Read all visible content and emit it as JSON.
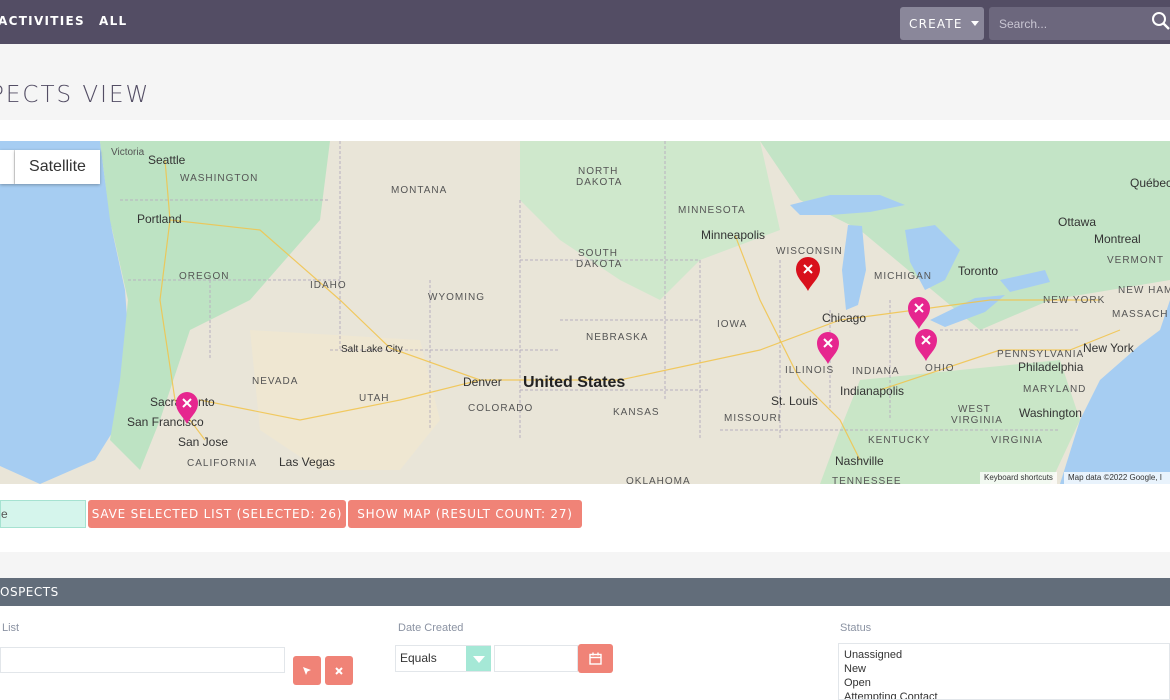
{
  "nav": {
    "items": [
      "ACTIVITIES",
      "ALL"
    ],
    "create_label": "CREATE",
    "search_placeholder": "Search..."
  },
  "page": {
    "title": "PECTS VIEW"
  },
  "map": {
    "type_satellite": "Satellite",
    "attribution_shortcuts": "Keyboard shortcuts",
    "attribution_data": "Map data ©2022 Google, I",
    "labels": {
      "victoria": "Victoria",
      "seattle": "Seattle",
      "washington": "WASHINGTON",
      "portland": "Portland",
      "oregon": "OREGON",
      "idaho": "IDAHO",
      "montana": "MONTANA",
      "wyoming": "WYOMING",
      "nevada": "NEVADA",
      "utah": "UTAH",
      "colorado": "COLORADO",
      "california": "CALIFORNIA",
      "sacramento": "Sacramento",
      "san_francisco": "San Francisco",
      "san_jose": "San Jose",
      "las_vegas": "Las Vegas",
      "salt_lake": "Salt Lake City",
      "denver": "Denver",
      "united_states": "United States",
      "north_dakota_1": "NORTH",
      "north_dakota_2": "DAKOTA",
      "south_dakota_1": "SOUTH",
      "south_dakota_2": "DAKOTA",
      "nebraska": "NEBRASKA",
      "kansas": "KANSAS",
      "oklahoma": "OKLAHOMA",
      "minnesota": "MINNESOTA",
      "minneapolis": "Minneapolis",
      "wisconsin": "WISCONSIN",
      "iowa": "IOWA",
      "illinois": "ILLINOIS",
      "missouri": "MISSOURI",
      "st_louis": "St. Louis",
      "chicago": "Chicago",
      "indiana": "INDIANA",
      "indianapolis": "Indianapolis",
      "michigan": "MICHIGAN",
      "ohio": "OHIO",
      "kentucky": "KENTUCKY",
      "tennessee": "TENNESSEE",
      "nashville": "Nashville",
      "toronto": "Toronto",
      "ottawa": "Ottawa",
      "montreal": "Montreal",
      "quebec": "Québec",
      "new_york_state": "NEW YORK",
      "new_york": "New York",
      "vermont": "VERMONT",
      "new_hamps": "NEW HAMPS",
      "massach": "MASSACH",
      "pennsylvania": "PENNSYLVANIA",
      "philadelphia": "Philadelphia",
      "maryland": "MARYLAND",
      "washington_dc": "Washington",
      "west_virginia_1": "WEST",
      "west_virginia_2": "VIRGINIA",
      "virginia": "VIRGINIA"
    }
  },
  "actions": {
    "mint_value": "e",
    "save_label": "SAVE SELECTED LIST  (SELECTED: 26)",
    "show_label": "SHOW MAP  (RESULT COUNT: 27)"
  },
  "filter": {
    "header": "OSPECTS",
    "list_label": "List",
    "date_label": "Date Created",
    "date_operator": "Equals",
    "status_label": "Status",
    "status_options": [
      "Unassigned",
      "New",
      "Open",
      "Attempting Contact"
    ]
  },
  "colors": {
    "nav": "#534d64",
    "coral": "#f08377",
    "pin_pink": "#e6268f",
    "pin_red": "#d8101c"
  }
}
